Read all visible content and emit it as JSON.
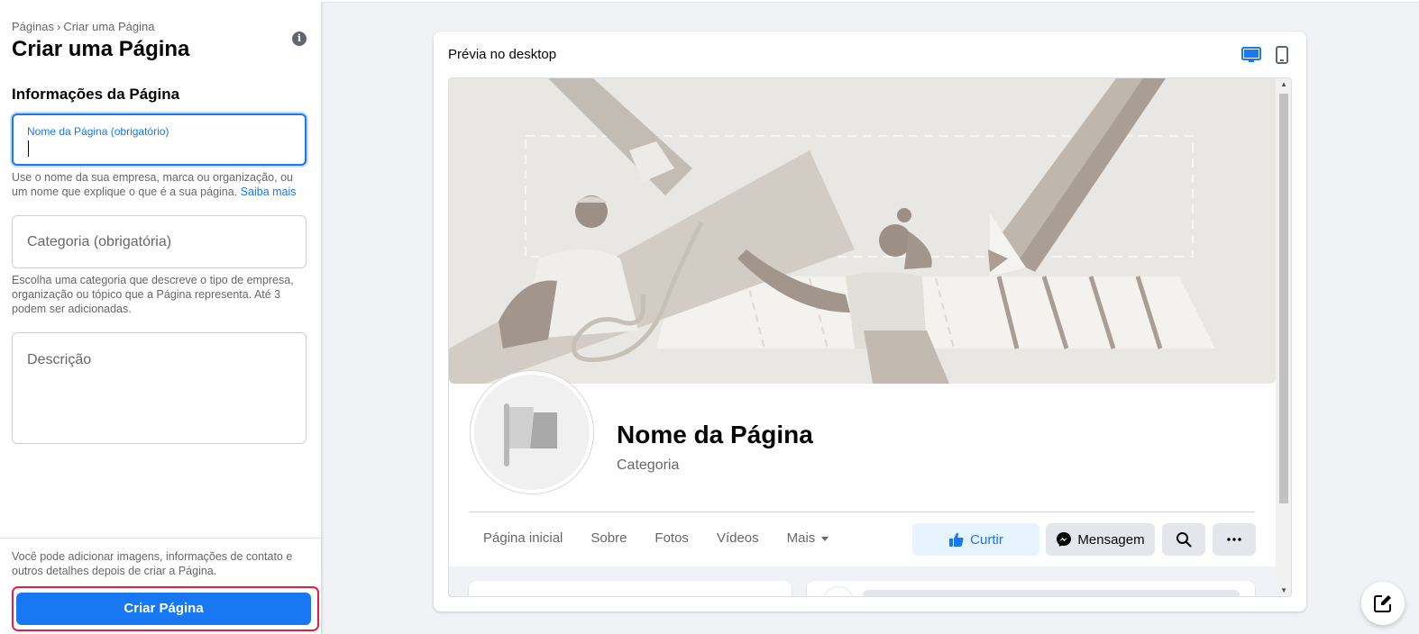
{
  "sidebar": {
    "breadcrumb": {
      "parent": "Páginas",
      "separator": "›",
      "current": "Criar uma Página"
    },
    "title": "Criar uma Página",
    "section_heading": "Informações da Página",
    "name_field": {
      "label": "Nome da Página (obrigatório)",
      "value": ""
    },
    "name_help": "Use o nome da sua empresa, marca ou organização, ou um nome que explique o que é a sua página.",
    "learn_more": "Saiba mais",
    "category_field": {
      "placeholder": "Categoria (obrigatória)"
    },
    "category_help": "Escolha uma categoria que descreve o tipo de empresa, organização ou tópico que a Página representa. Até 3 podem ser adicionadas.",
    "description_field": {
      "placeholder": "Descrição"
    },
    "bottom_note": "Você pode adicionar imagens, informações de contato e outros detalhes depois de criar a Página.",
    "create_button": "Criar Página"
  },
  "preview": {
    "title": "Prévia no desktop",
    "page_name": "Nome da Página",
    "category": "Categoria",
    "tabs": [
      "Página inicial",
      "Sobre",
      "Fotos",
      "Vídeos",
      "Mais"
    ],
    "like_button": "Curtir",
    "message_button": "Mensagem"
  },
  "colors": {
    "accent": "#1877f2",
    "highlight_border": "#e41e3f",
    "like_bg": "#e7f3ff",
    "secondary_btn": "#e4e6eb"
  },
  "icons": [
    "info-icon",
    "desktop-icon",
    "mobile-icon",
    "flag-icon",
    "thumbs-up-icon",
    "messenger-icon",
    "search-icon",
    "more-icon",
    "edit-icon"
  ]
}
